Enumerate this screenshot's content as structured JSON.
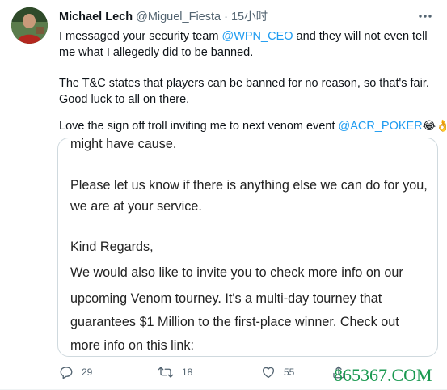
{
  "tweet": {
    "author_name": "Michael Lech",
    "handle": "@Miguel_Fiesta",
    "separator": "·",
    "time": "15小时",
    "more_icon": "more-horizontal-icon",
    "text": {
      "p1_a": "I messaged your security team ",
      "p1_mention": "@WPN_CEO",
      "p1_b": " and they will not even tell me what I allegedly did to be banned.",
      "p2": "The T&C states that players can be banned for no reason, so that's fair. Good luck to all on there.",
      "p3_a": "Love the sign off troll inviting me to next venom event ",
      "p3_mention": "@ACR_POKER",
      "p3_emoji": "😂👌"
    }
  },
  "media": {
    "lines": [
      "might have cause.",
      "Please let us know if there is anything else we can do for you,",
      "we are at your service.",
      "Kind Regards,",
      "We would also like to invite you to check more info on our",
      "upcoming Venom tourney. It's a multi-day tourney that",
      "guarantees $1 Million to the first-place winner. Check out",
      "more info on this link:"
    ]
  },
  "actions": {
    "reply_count": "29",
    "retweet_count": "18",
    "like_count": "55"
  },
  "watermark": "865367.COM",
  "colors": {
    "accent": "#1d9bf0",
    "secondary_text": "#536471",
    "watermark": "#1a9950",
    "border": "#cfd9de"
  }
}
